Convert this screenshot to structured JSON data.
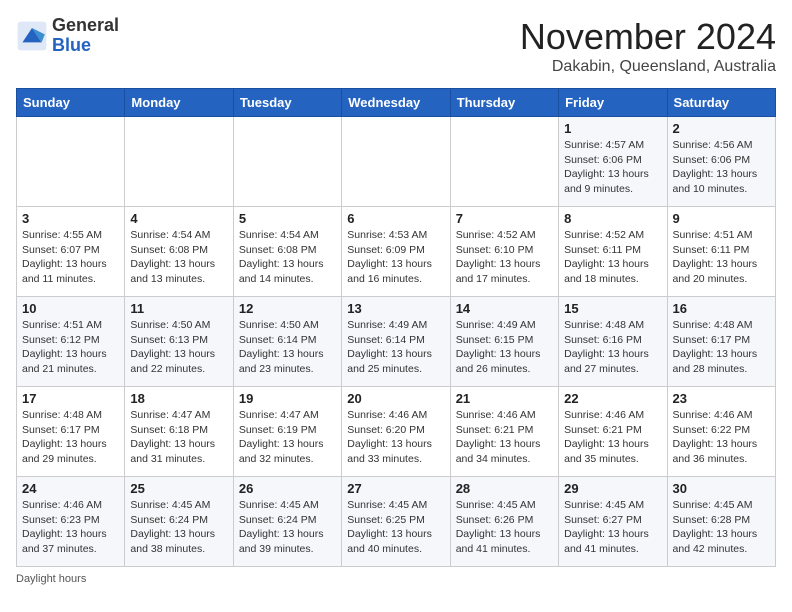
{
  "header": {
    "logo_general": "General",
    "logo_blue": "Blue",
    "month_title": "November 2024",
    "location": "Dakabin, Queensland, Australia"
  },
  "days_of_week": [
    "Sunday",
    "Monday",
    "Tuesday",
    "Wednesday",
    "Thursday",
    "Friday",
    "Saturday"
  ],
  "weeks": [
    [
      {
        "day": "",
        "info": ""
      },
      {
        "day": "",
        "info": ""
      },
      {
        "day": "",
        "info": ""
      },
      {
        "day": "",
        "info": ""
      },
      {
        "day": "",
        "info": ""
      },
      {
        "day": "1",
        "info": "Sunrise: 4:57 AM\nSunset: 6:06 PM\nDaylight: 13 hours and 9 minutes."
      },
      {
        "day": "2",
        "info": "Sunrise: 4:56 AM\nSunset: 6:06 PM\nDaylight: 13 hours and 10 minutes."
      }
    ],
    [
      {
        "day": "3",
        "info": "Sunrise: 4:55 AM\nSunset: 6:07 PM\nDaylight: 13 hours and 11 minutes."
      },
      {
        "day": "4",
        "info": "Sunrise: 4:54 AM\nSunset: 6:08 PM\nDaylight: 13 hours and 13 minutes."
      },
      {
        "day": "5",
        "info": "Sunrise: 4:54 AM\nSunset: 6:08 PM\nDaylight: 13 hours and 14 minutes."
      },
      {
        "day": "6",
        "info": "Sunrise: 4:53 AM\nSunset: 6:09 PM\nDaylight: 13 hours and 16 minutes."
      },
      {
        "day": "7",
        "info": "Sunrise: 4:52 AM\nSunset: 6:10 PM\nDaylight: 13 hours and 17 minutes."
      },
      {
        "day": "8",
        "info": "Sunrise: 4:52 AM\nSunset: 6:11 PM\nDaylight: 13 hours and 18 minutes."
      },
      {
        "day": "9",
        "info": "Sunrise: 4:51 AM\nSunset: 6:11 PM\nDaylight: 13 hours and 20 minutes."
      }
    ],
    [
      {
        "day": "10",
        "info": "Sunrise: 4:51 AM\nSunset: 6:12 PM\nDaylight: 13 hours and 21 minutes."
      },
      {
        "day": "11",
        "info": "Sunrise: 4:50 AM\nSunset: 6:13 PM\nDaylight: 13 hours and 22 minutes."
      },
      {
        "day": "12",
        "info": "Sunrise: 4:50 AM\nSunset: 6:14 PM\nDaylight: 13 hours and 23 minutes."
      },
      {
        "day": "13",
        "info": "Sunrise: 4:49 AM\nSunset: 6:14 PM\nDaylight: 13 hours and 25 minutes."
      },
      {
        "day": "14",
        "info": "Sunrise: 4:49 AM\nSunset: 6:15 PM\nDaylight: 13 hours and 26 minutes."
      },
      {
        "day": "15",
        "info": "Sunrise: 4:48 AM\nSunset: 6:16 PM\nDaylight: 13 hours and 27 minutes."
      },
      {
        "day": "16",
        "info": "Sunrise: 4:48 AM\nSunset: 6:17 PM\nDaylight: 13 hours and 28 minutes."
      }
    ],
    [
      {
        "day": "17",
        "info": "Sunrise: 4:48 AM\nSunset: 6:17 PM\nDaylight: 13 hours and 29 minutes."
      },
      {
        "day": "18",
        "info": "Sunrise: 4:47 AM\nSunset: 6:18 PM\nDaylight: 13 hours and 31 minutes."
      },
      {
        "day": "19",
        "info": "Sunrise: 4:47 AM\nSunset: 6:19 PM\nDaylight: 13 hours and 32 minutes."
      },
      {
        "day": "20",
        "info": "Sunrise: 4:46 AM\nSunset: 6:20 PM\nDaylight: 13 hours and 33 minutes."
      },
      {
        "day": "21",
        "info": "Sunrise: 4:46 AM\nSunset: 6:21 PM\nDaylight: 13 hours and 34 minutes."
      },
      {
        "day": "22",
        "info": "Sunrise: 4:46 AM\nSunset: 6:21 PM\nDaylight: 13 hours and 35 minutes."
      },
      {
        "day": "23",
        "info": "Sunrise: 4:46 AM\nSunset: 6:22 PM\nDaylight: 13 hours and 36 minutes."
      }
    ],
    [
      {
        "day": "24",
        "info": "Sunrise: 4:46 AM\nSunset: 6:23 PM\nDaylight: 13 hours and 37 minutes."
      },
      {
        "day": "25",
        "info": "Sunrise: 4:45 AM\nSunset: 6:24 PM\nDaylight: 13 hours and 38 minutes."
      },
      {
        "day": "26",
        "info": "Sunrise: 4:45 AM\nSunset: 6:24 PM\nDaylight: 13 hours and 39 minutes."
      },
      {
        "day": "27",
        "info": "Sunrise: 4:45 AM\nSunset: 6:25 PM\nDaylight: 13 hours and 40 minutes."
      },
      {
        "day": "28",
        "info": "Sunrise: 4:45 AM\nSunset: 6:26 PM\nDaylight: 13 hours and 41 minutes."
      },
      {
        "day": "29",
        "info": "Sunrise: 4:45 AM\nSunset: 6:27 PM\nDaylight: 13 hours and 41 minutes."
      },
      {
        "day": "30",
        "info": "Sunrise: 4:45 AM\nSunset: 6:28 PM\nDaylight: 13 hours and 42 minutes."
      }
    ]
  ],
  "footer": {
    "daylight_label": "Daylight hours"
  }
}
